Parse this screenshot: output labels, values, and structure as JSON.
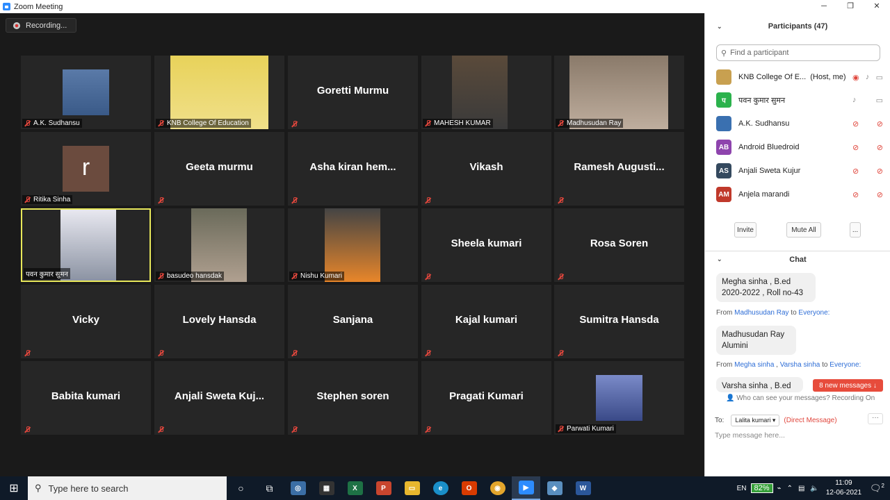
{
  "window": {
    "title": "Zoom Meeting",
    "minimize": "─",
    "maximize": "❐",
    "close": "✕"
  },
  "recording": "Recording...",
  "tiles": [
    {
      "name": "A.K. Sudhansu",
      "label": "A.K. Sudhansu",
      "video": true
    },
    {
      "name": "KNB College Of Education",
      "label": "KNB College Of Education",
      "video": true
    },
    {
      "name": "Goretti Murmu",
      "label": "",
      "video": false
    },
    {
      "name": "MAHESH KUMAR",
      "label": "MAHESH KUMAR",
      "video": true
    },
    {
      "name": "Madhusudan Ray",
      "label": "Madhusudan Ray",
      "video": true
    },
    {
      "name": "Ritika Sinha",
      "label": "Ritika Sinha",
      "video": true
    },
    {
      "name": "Geeta murmu",
      "label": "",
      "video": false
    },
    {
      "name": "Asha  kiran  hem...",
      "label": "",
      "video": false
    },
    {
      "name": "Vikash",
      "label": "",
      "video": false
    },
    {
      "name": "Ramesh  Augusti...",
      "label": "",
      "video": false
    },
    {
      "name": "पवन कुमार सुमन",
      "label": "पवन कुमार सुमन",
      "video": true
    },
    {
      "name": "basudeo hansdak",
      "label": "basudeo hansdak",
      "video": true
    },
    {
      "name": "Nishu Kumari",
      "label": "Nishu Kumari",
      "video": true
    },
    {
      "name": "Sheela kumari",
      "label": "",
      "video": false
    },
    {
      "name": "Rosa Soren",
      "label": "",
      "video": false
    },
    {
      "name": "Vicky",
      "label": "",
      "video": false
    },
    {
      "name": "Lovely Hansda",
      "label": "",
      "video": false
    },
    {
      "name": "Sanjana",
      "label": "",
      "video": false
    },
    {
      "name": "Kajal kumari",
      "label": "",
      "video": false
    },
    {
      "name": "Sumitra Hansda",
      "label": "",
      "video": false
    },
    {
      "name": "Babita kumari",
      "label": "",
      "video": false
    },
    {
      "name": "Anjali  Sweta  Kuj...",
      "label": "",
      "video": false
    },
    {
      "name": "Stephen soren",
      "label": "",
      "video": false
    },
    {
      "name": "Pragati Kumari",
      "label": "",
      "video": false
    },
    {
      "name": "Parwati Kumari",
      "label": "Parwati Kumari",
      "video": true
    }
  ],
  "photos": {
    "ritika_avatar": "r"
  },
  "participants": {
    "title": "Participants (47)",
    "search_placeholder": "Find a participant",
    "list": [
      {
        "initials": "",
        "name": "KNB College Of E...",
        "role": "(Host, me)",
        "color": "#c8a050"
      },
      {
        "initials": "प",
        "name": "पवन कुमार सुमन",
        "role": "",
        "color": "#2bb24c"
      },
      {
        "initials": "",
        "name": "A.K. Sudhansu",
        "role": "",
        "color": "#3a70b0"
      },
      {
        "initials": "AB",
        "name": "Android Bluedroid",
        "role": "",
        "color": "#8e44ad"
      },
      {
        "initials": "AS",
        "name": "Anjali Sweta Kujur",
        "role": "",
        "color": "#34495e"
      },
      {
        "initials": "AM",
        "name": "Anjela marandi",
        "role": "",
        "color": "#c0392b"
      }
    ],
    "invite": "Invite",
    "mute_all": "Mute All",
    "more": "..."
  },
  "chat": {
    "title": "Chat",
    "messages": [
      {
        "text": "Megha sinha  , B.ed 2020-2022 , Roll no-43"
      },
      {
        "from_prefix": "From",
        "from": "Madhusudan Ray",
        "to_word": "to",
        "to": "Everyone:",
        "text": "Madhusudan Ray Alumini"
      },
      {
        "from_prefix": "From",
        "from": "Megha sinha",
        "from2": "Varsha sinha",
        "to_word": "to",
        "to": "Everyone:",
        "text": "Varsha sinha  , B.ed"
      }
    ],
    "new_messages": "8 new messages ↓",
    "who_can_see": "Who can see your messages? Recording On",
    "to_label": "To:",
    "to_value": "Lalita kumari ▾",
    "direct": "(Direct Message)",
    "input_placeholder": "Type message here...",
    "more": "···"
  },
  "taskbar": {
    "search": "Type here to search",
    "lang": "EN",
    "battery": "82%",
    "time": "11:09",
    "date": "12-06-2021",
    "notif": "2"
  }
}
